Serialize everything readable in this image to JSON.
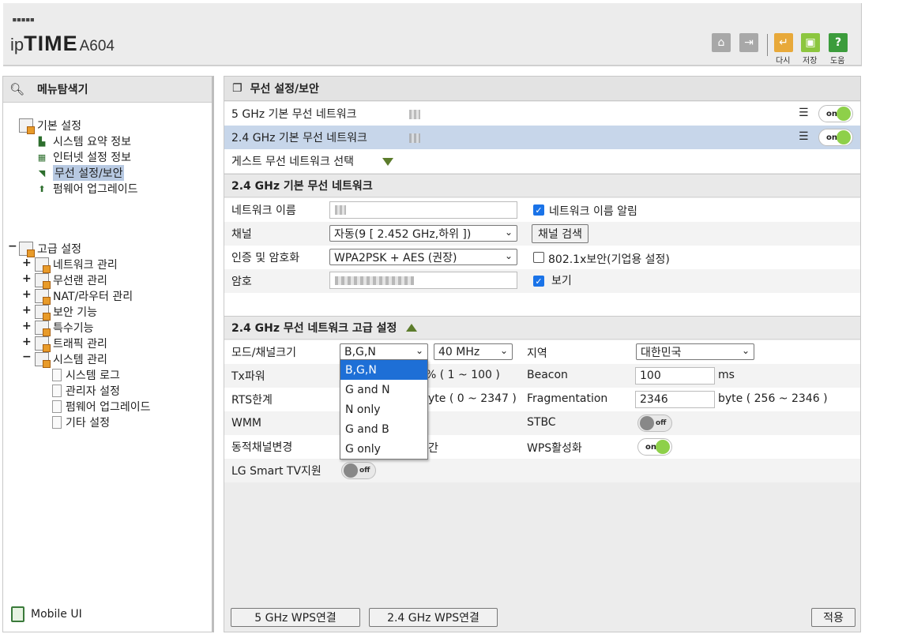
{
  "header": {
    "logo_dots": "▪▪▪▪▪",
    "logo_ip": "ip",
    "logo_time": "TIME",
    "logo_model": "A604",
    "actions": [
      {
        "name": "home",
        "icon": "home-icon",
        "glyph": "⌂"
      },
      {
        "name": "logout",
        "icon": "logout-icon",
        "glyph": "⇥"
      },
      {
        "name": "reload",
        "icon": "reload-icon",
        "glyph": "↵",
        "label": "다시"
      },
      {
        "name": "save",
        "icon": "save-icon",
        "glyph": "▣",
        "label": "저장"
      },
      {
        "name": "help",
        "icon": "help-icon",
        "glyph": "?",
        "label": "도움"
      }
    ]
  },
  "sidebar": {
    "title": "메뉴탐색기",
    "basic": {
      "label": "기본 설정",
      "items": [
        "시스템 요약 정보",
        "인터넷 설정 정보",
        "무선 설정/보안",
        "펌웨어 업그레이드"
      ],
      "selected": "무선 설정/보안"
    },
    "advanced": {
      "label": "고급 설정",
      "items": [
        "네트워크 관리",
        "무선랜 관리",
        "NAT/라우터 관리",
        "보안 기능",
        "특수기능",
        "트래픽 관리",
        "시스템 관리"
      ],
      "system_sub": [
        "시스템 로그",
        "관리자 설정",
        "펌웨어 업그레이드",
        "기타 설정"
      ]
    },
    "mobile_ui": "Mobile UI"
  },
  "main": {
    "title": "무선 설정/보안",
    "networks": [
      {
        "label": "5 GHz 기본 무선 네트워크",
        "state": "on"
      },
      {
        "label": "2.4 GHz 기본 무선 네트워크",
        "state": "on"
      }
    ],
    "guest_label": "게스트 무선 네트워크 선택",
    "basic_section": {
      "title": "2.4 GHz 기본 무선 네트워크",
      "network_name_label": "네트워크 이름",
      "broadcast_label": "네트워크 이름 알림",
      "channel_label": "채널",
      "channel_value": "자동(9 [ 2.452 GHz,하위 ])",
      "channel_search": "채널 검색",
      "auth_label": "인증 및 암호화",
      "auth_value": "WPA2PSK + AES (권장)",
      "enterprise_label": "802.1x보안(기업용 설정)",
      "password_label": "암호",
      "show_label": "보기"
    },
    "advanced_section": {
      "title": "2.4 GHz 무선 네트워크 고급 설정",
      "mode_label": "모드/채널크기",
      "mode_value": "B,G,N",
      "width_value": "40 MHz",
      "region_label": "지역",
      "region_value": "대한민국",
      "tx_label": "Tx파워",
      "tx_range": "% ( 1 ~ 100 )",
      "beacon_label": "Beacon",
      "beacon_value": "100",
      "beacon_unit": "ms",
      "rts_label": "RTS한계",
      "rts_range": "yte ( 0 ~ 2347 )",
      "frag_label": "Fragmentation",
      "frag_value": "2346",
      "frag_range": "byte ( 256 ~ 2346 )",
      "wmm_label": "WMM",
      "stbc_label": "STBC",
      "stbc_state": "off",
      "dyn_label": "동적채널변경",
      "dyn_suffix": "간",
      "wps_label": "WPS활성화",
      "wps_state": "on",
      "lg_label": "LG Smart TV지원",
      "lg_state": "off"
    },
    "mode_options": [
      "B,G,N",
      "G and N",
      "N only",
      "G and B",
      "G only"
    ],
    "buttons": {
      "wps5": "5 GHz WPS연결",
      "wps24": "2.4 GHz WPS연결",
      "apply": "적용"
    }
  }
}
